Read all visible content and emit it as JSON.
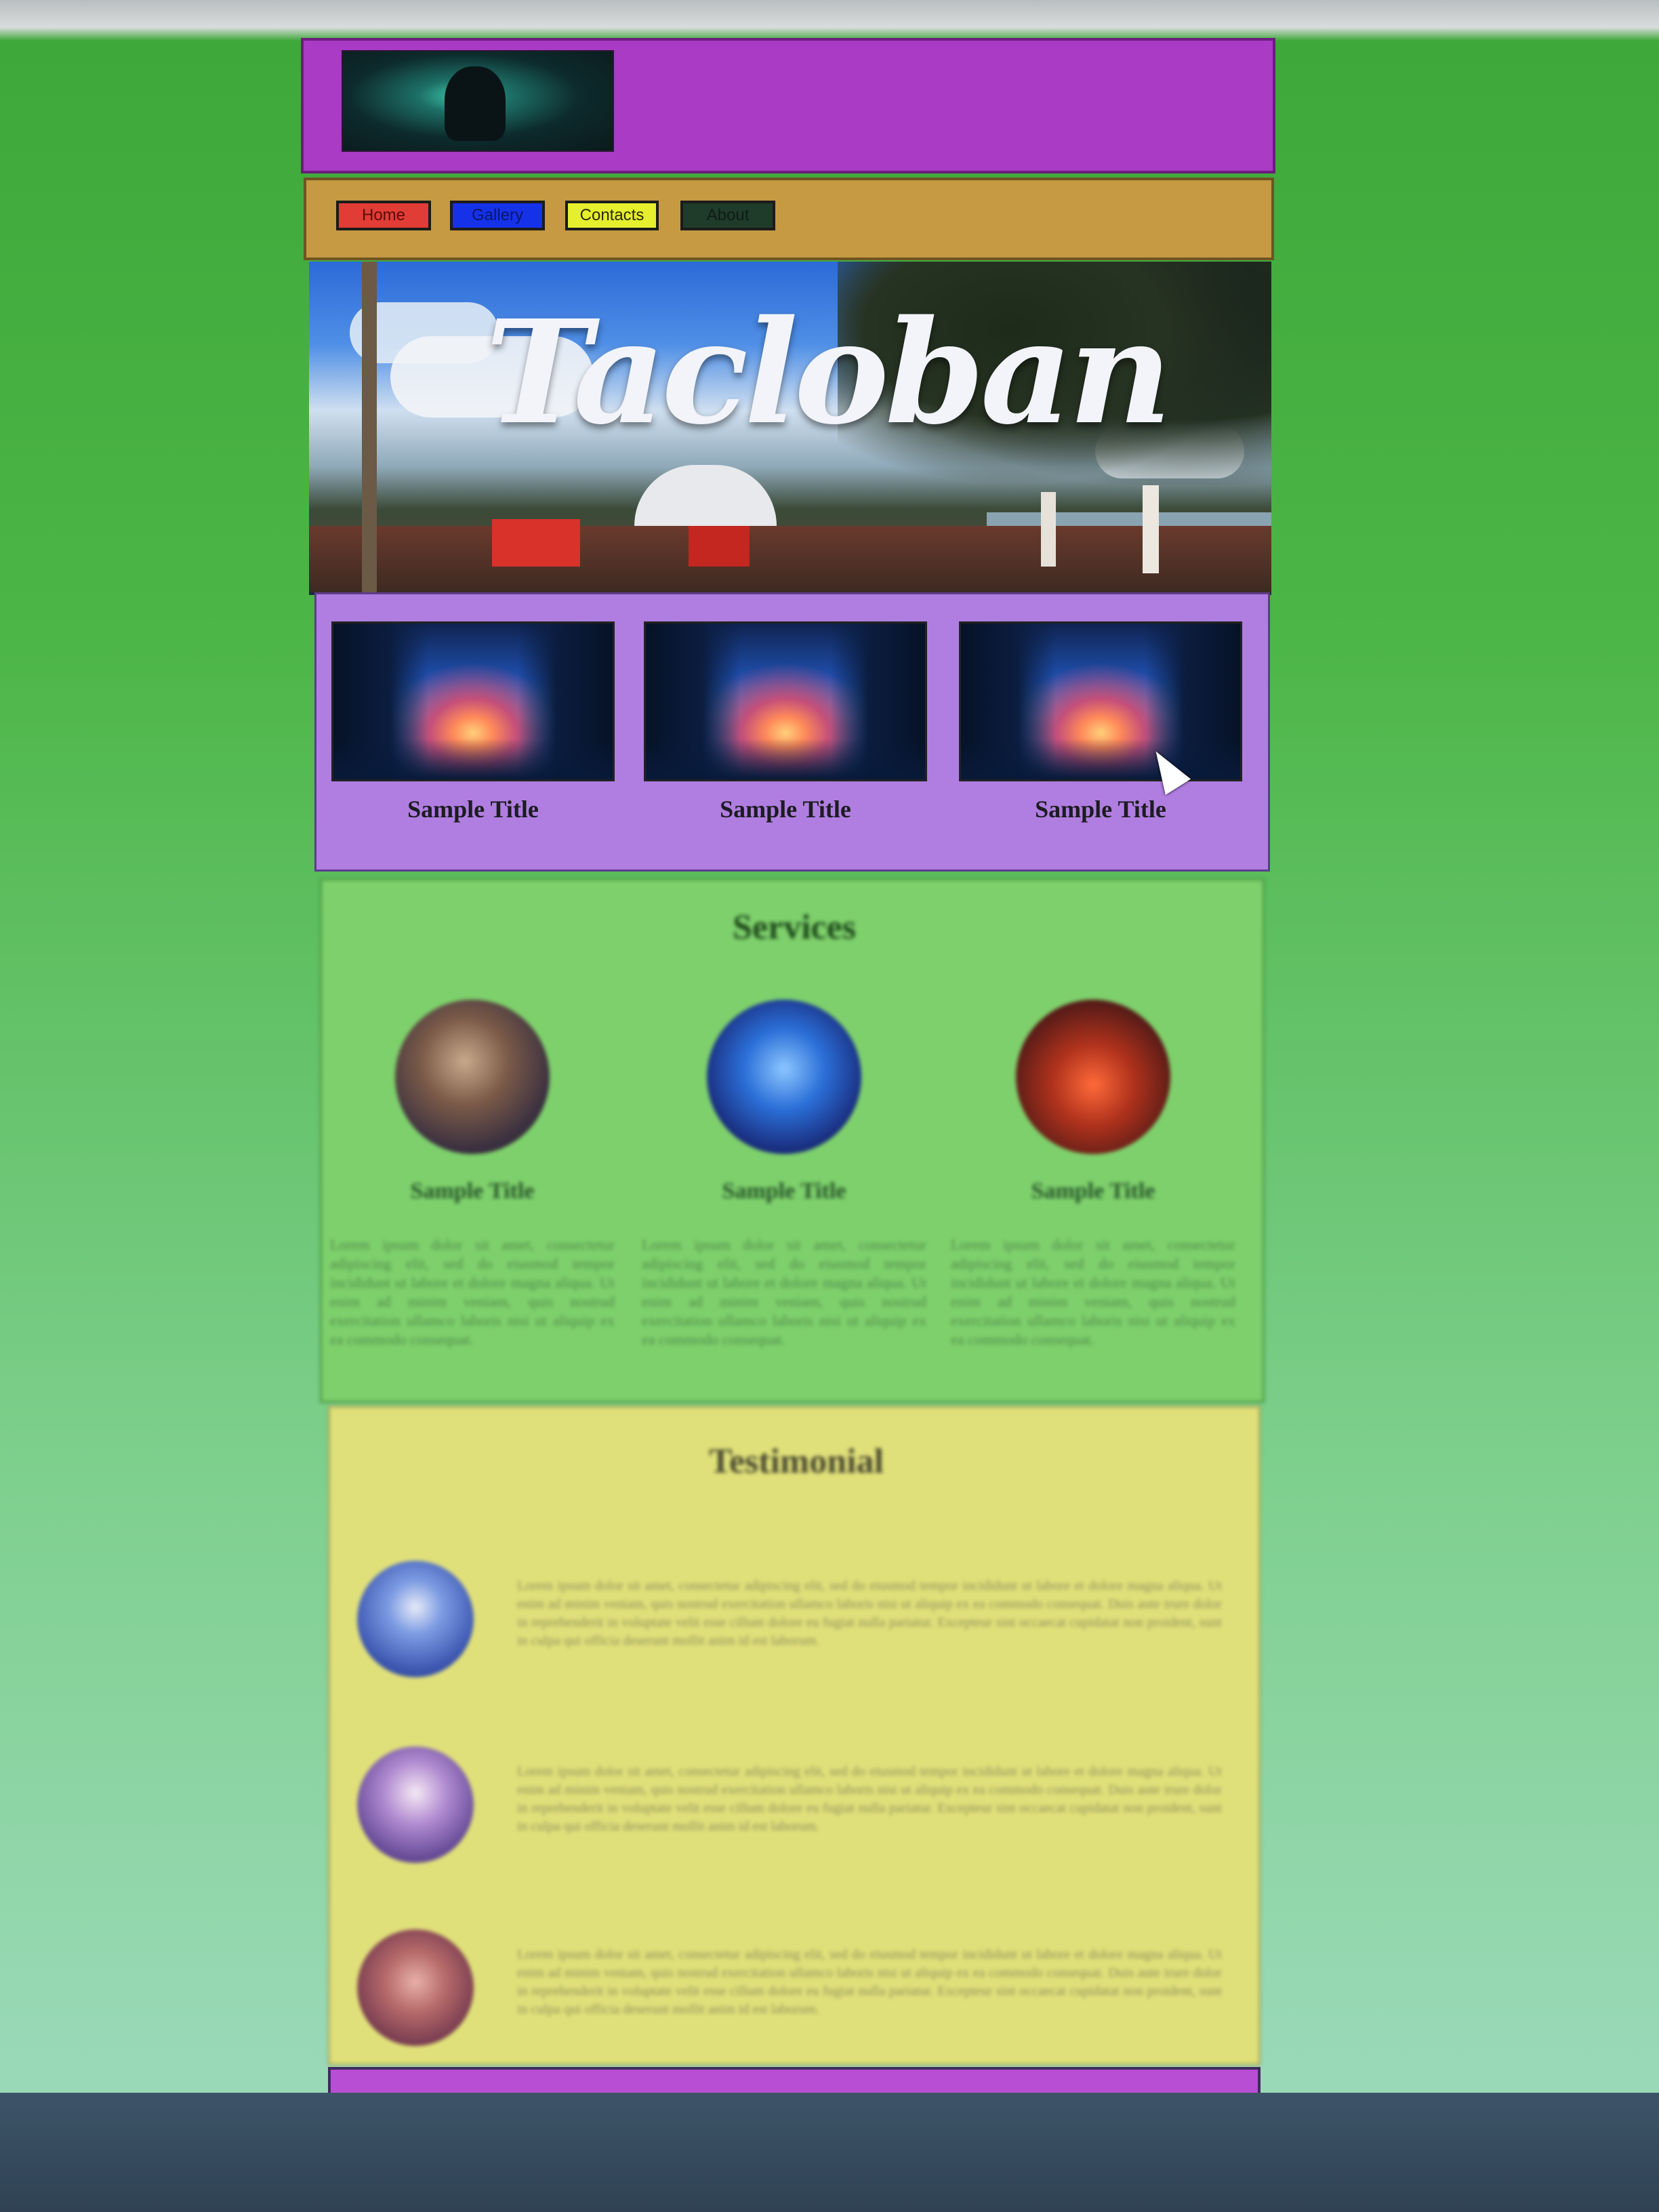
{
  "nav": {
    "home": "Home",
    "gallery": "Gallery",
    "contacts": "Contacts",
    "about": "About"
  },
  "hero": {
    "title": "Tacloban"
  },
  "gallery": {
    "items": [
      {
        "title": "Sample Title"
      },
      {
        "title": "Sample Title"
      },
      {
        "title": "Sample Title"
      }
    ]
  },
  "services": {
    "heading": "Services",
    "items": [
      {
        "title": "Sample Title",
        "text": "Lorem ipsum dolor sit amet, consectetur adipiscing elit, sed do eiusmod tempor incididunt ut labore et dolore magna aliqua. Ut enim ad minim veniam, quis nostrud exercitation ullamco laboris nisi ut aliquip ex ea commodo consequat."
      },
      {
        "title": "Sample Title",
        "text": "Lorem ipsum dolor sit amet, consectetur adipiscing elit, sed do eiusmod tempor incididunt ut labore et dolore magna aliqua. Ut enim ad minim veniam, quis nostrud exercitation ullamco laboris nisi ut aliquip ex ea commodo consequat."
      },
      {
        "title": "Sample Title",
        "text": "Lorem ipsum dolor sit amet, consectetur adipiscing elit, sed do eiusmod tempor incididunt ut labore et dolore magna aliqua. Ut enim ad minim veniam, quis nostrud exercitation ullamco laboris nisi ut aliquip ex ea commodo consequat."
      }
    ]
  },
  "testimonial": {
    "heading": "Testimonial",
    "items": [
      {
        "text": "Lorem ipsum dolor sit amet, consectetur adipiscing elit, sed do eiusmod tempor incididunt ut labore et dolore magna aliqua. Ut enim ad minim veniam, quis nostrud exercitation ullamco laboris nisi ut aliquip ex ea commodo consequat. Duis aute irure dolor in reprehenderit in voluptate velit esse cillum dolore eu fugiat nulla pariatur. Excepteur sint occaecat cupidatat non proident, sunt in culpa qui officia deserunt mollit anim id est laborum."
      },
      {
        "text": "Lorem ipsum dolor sit amet, consectetur adipiscing elit, sed do eiusmod tempor incididunt ut labore et dolore magna aliqua. Ut enim ad minim veniam, quis nostrud exercitation ullamco laboris nisi ut aliquip ex ea commodo consequat. Duis aute irure dolor in reprehenderit in voluptate velit esse cillum dolore eu fugiat nulla pariatur. Excepteur sint occaecat cupidatat non proident, sunt in culpa qui officia deserunt mollit anim id est laborum."
      },
      {
        "text": "Lorem ipsum dolor sit amet, consectetur adipiscing elit, sed do eiusmod tempor incididunt ut labore et dolore magna aliqua. Ut enim ad minim veniam, quis nostrud exercitation ullamco laboris nisi ut aliquip ex ea commodo consequat. Duis aute irure dolor in reprehenderit in voluptate velit esse cillum dolore eu fugiat nulla pariatur. Excepteur sint occaecat cupidatat non proident, sunt in culpa qui officia deserunt mollit anim id est laborum."
      }
    ]
  },
  "colors": {
    "header": "#a93bc4",
    "nav": "#c59a43",
    "gallery": "#b07ee0",
    "services": "#7ed06c",
    "testimonial": "#e0e07a",
    "footer": "#b84ed3"
  },
  "icons": {
    "logo": "logo-image",
    "cursor": "mouse-cursor-icon"
  }
}
